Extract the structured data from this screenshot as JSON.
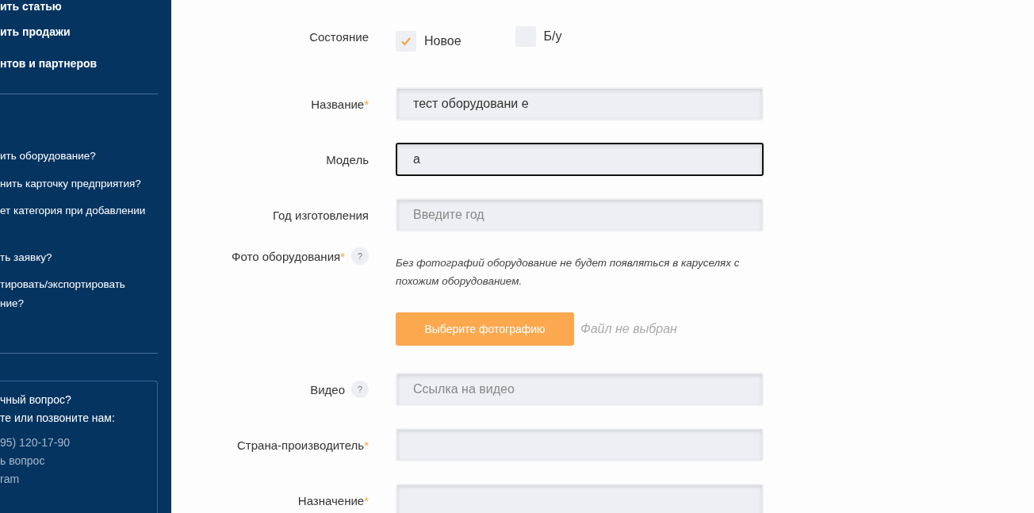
{
  "sidebar": {
    "menu": [
      "ить статью",
      "ить продажи",
      "нтов и партнеров"
    ],
    "help_links": [
      {
        "lines": [
          "ить оборудование?"
        ]
      },
      {
        "lines": [
          "нить карточку предприятия?"
        ]
      },
      {
        "lines": [
          "ет категория при добавлении"
        ]
      },
      {
        "lines": [
          "ть заявку?"
        ]
      },
      {
        "lines": [
          "тировать/экспортировать",
          "ние?"
        ]
      }
    ],
    "contact": {
      "heading": [
        "чный вопрос?",
        "те или позвоните нам:"
      ],
      "phone": "95) 120-17-90",
      "links": [
        "ь вопрос",
        "ram"
      ]
    }
  },
  "form": [
    {
      "kind": "condition",
      "label": "Состояние",
      "options": [
        {
          "label": "Новое",
          "checked": true
        },
        {
          "label": "Б/у",
          "checked": false
        }
      ]
    },
    {
      "kind": "text",
      "label": "Название",
      "required_mark": "*",
      "focused": false,
      "value": "тест оборудовани е"
    },
    {
      "kind": "text",
      "label": "Модель",
      "focused": true,
      "value": "а"
    },
    {
      "kind": "text",
      "label": "Год изготовления",
      "focused": false,
      "placeholder": "Введите год"
    },
    {
      "kind": "photo",
      "label": "Фото оборудования",
      "required_mark": "*",
      "help": "?",
      "note": "Без фотографий оборудование не будет появляться в каруселях с похожим оборудованием.",
      "button": "Выберите фотографию",
      "file_status": "Файл не выбран"
    },
    {
      "kind": "text",
      "label": "Видео",
      "help": "?",
      "focused": false,
      "placeholder": "Ссылка на видео"
    },
    {
      "kind": "text",
      "label": "Страна-производитель",
      "required_mark": "*",
      "focused": false
    },
    {
      "kind": "text",
      "label": "Назначение",
      "required_mark": "*",
      "focused": false
    }
  ]
}
